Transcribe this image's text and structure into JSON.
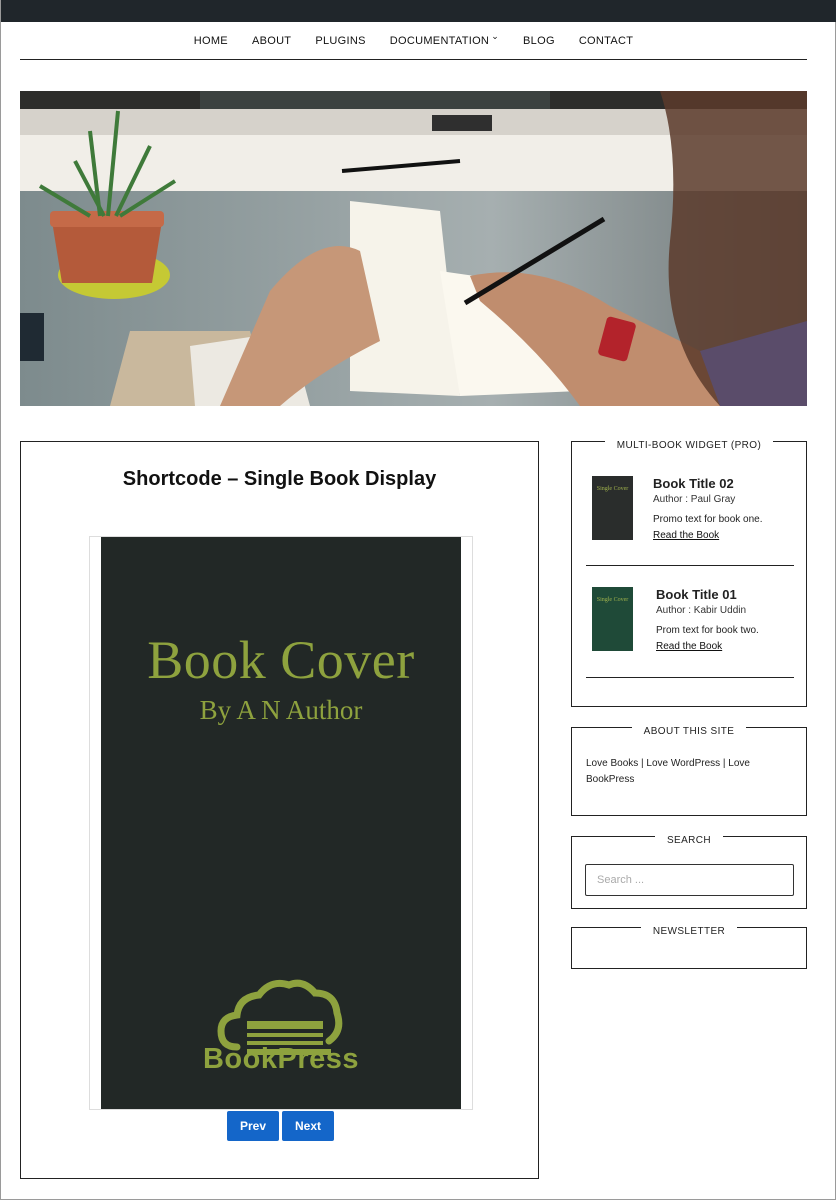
{
  "nav": {
    "items": [
      {
        "label": "HOME"
      },
      {
        "label": "ABOUT"
      },
      {
        "label": "PLUGINS"
      },
      {
        "label": "DOCUMENTATION",
        "has_dropdown": true
      },
      {
        "label": "BLOG"
      },
      {
        "label": "CONTACT"
      }
    ]
  },
  "hero": {
    "image": "desk-writing-photo"
  },
  "main": {
    "title": "Shortcode – Single Book Display",
    "cover": {
      "title": "Book Cover",
      "author": "By A N Author",
      "logo_text": "BookPress",
      "background": "#222826",
      "accent": "#8ea23e"
    },
    "pager": {
      "prev": "Prev",
      "next": "Next",
      "color": "#1466c9"
    }
  },
  "sidebar": {
    "multibook": {
      "title": "MULTI-BOOK WIDGET (PRO)",
      "books": [
        {
          "title": "Book Title 02",
          "author": "Author : Paul Gray",
          "promo": "Promo text for book one.",
          "link": "Read the Book",
          "thumb_color": "#2a2d2c",
          "thumb_text": "Single Cover"
        },
        {
          "title": "Book Title 01",
          "author": "Author : Kabir Uddin",
          "promo": "Prom text for book two.",
          "link": "Read the Book",
          "thumb_color": "#1f4a38",
          "thumb_text": "Single Cover"
        }
      ]
    },
    "about": {
      "title": "ABOUT THIS SITE",
      "text": "Love Books | Love WordPress | Love BookPress"
    },
    "search": {
      "title": "SEARCH",
      "placeholder": "Search ..."
    },
    "newsletter": {
      "title": "NEWSLETTER"
    }
  }
}
